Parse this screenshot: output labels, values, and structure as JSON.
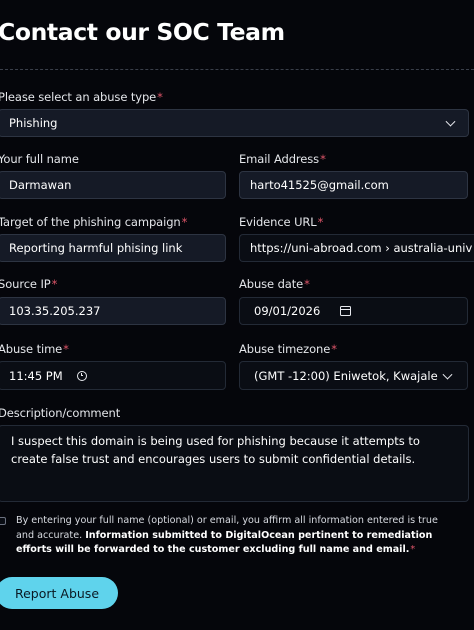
{
  "page": {
    "title": "Contact our SOC Team"
  },
  "form": {
    "abuse_type": {
      "label": "Please select an abuse type",
      "value": "Phishing"
    },
    "full_name": {
      "label": "Your full name",
      "value": "Darmawan"
    },
    "email": {
      "label": "Email Address",
      "value": "harto41525@gmail.com"
    },
    "target": {
      "label": "Target of the phishing campaign",
      "value": "Reporting harmful phising link"
    },
    "evidence_url": {
      "label": "Evidence URL",
      "value": "https://uni-abroad.com › australia-univ"
    },
    "source_ip": {
      "label": "Source IP",
      "value": "103.35.205.237"
    },
    "abuse_date": {
      "label": "Abuse date",
      "value": "09/01/2026"
    },
    "abuse_time": {
      "label": "Abuse time",
      "value": "11:45 PM"
    },
    "abuse_timezone": {
      "label": "Abuse timezone",
      "value": "(GMT -12:00) Eniwetok, Kwajale"
    },
    "description": {
      "label": "Description/comment",
      "value": "I suspect this domain is being used for phishing because it attempts to create false trust and encourages users to submit confidential details."
    },
    "consent": {
      "text_plain": "By entering your full name (optional) or email, you affirm all information entered is true and accurate.",
      "text_bold": "Information submitted to DigitalOcean pertinent to remediation efforts will be forwarded to the customer excluding full name and email.",
      "checked": false
    },
    "required_marker": "*",
    "submit_label": "Report Abuse"
  },
  "colors": {
    "background": "#05060b",
    "accent_button": "#5fd3ec",
    "required": "#e0566a"
  },
  "icons": {
    "select": "chevron-down-icon",
    "date": "calendar-icon",
    "time": "clock-icon"
  }
}
